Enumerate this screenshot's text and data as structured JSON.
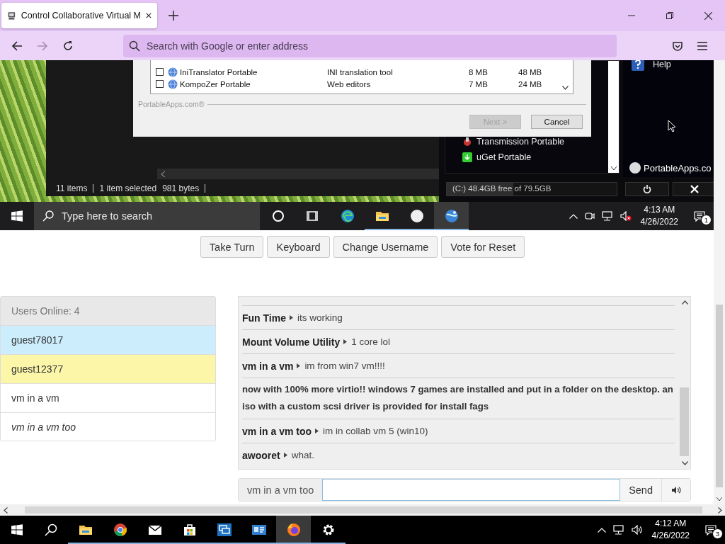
{
  "browser": {
    "tab": {
      "title": "Control Collaborative Virtual M",
      "selected": true
    },
    "nav": [
      {
        "kind": "back",
        "disabled": false
      },
      {
        "kind": "forward",
        "disabled": true
      },
      {
        "kind": "reload",
        "disabled": false
      }
    ],
    "address_placeholder": "Search with Google or enter address"
  },
  "vm_screen": {
    "installer": {
      "rows": [
        {
          "name": "IniTranslator Portable",
          "description": "INI translation tool",
          "column_3": "8 MB",
          "column_4": "48 MB",
          "checked": false
        },
        {
          "name": "KompoZer Portable",
          "description": "Web editors",
          "column_3": "7 MB",
          "column_4": "24 MB",
          "checked": false
        }
      ],
      "brand": "PortableApps.com®",
      "buttons": [
        {
          "label": "Next >",
          "disabled": true
        },
        {
          "label": "Cancel",
          "disabled": false
        }
      ]
    },
    "explorer_status": [
      "11 items",
      "1 item selected",
      "981 bytes"
    ],
    "menu": {
      "items": [
        {
          "label": "Transmission Portable",
          "kind": "transmission"
        },
        {
          "label": "uGet Portable",
          "kind": "uget"
        }
      ],
      "help": "Help",
      "logo": "PortableApps.co",
      "disk": "(C:) 48.4GB free of 79.5GB",
      "level": 0.39
    },
    "taskbar": {
      "search_placeholder": "Type here to search",
      "apps": [
        {
          "kind": "cortana",
          "running": false,
          "active": false
        },
        {
          "kind": "taskview",
          "running": false,
          "active": false
        },
        {
          "kind": "edge",
          "running": false,
          "active": false
        },
        {
          "kind": "folder",
          "running": true,
          "active": false
        },
        {
          "kind": "portableapps",
          "running": true,
          "active": false
        },
        {
          "kind": "globe",
          "running": true,
          "active": true
        }
      ],
      "time": "4:13 AM",
      "date": "4/26/2022",
      "notifications": "1"
    }
  },
  "controls": [
    "Take Turn",
    "Keyboard",
    "Change Username",
    "Vote for Reset"
  ],
  "users": {
    "header": "Users Online: 4",
    "items": [
      {
        "name": "guest78017",
        "kind": "turn"
      },
      {
        "name": "guest12377",
        "kind": "self"
      },
      {
        "name": "vm in a vm",
        "kind": "plain"
      },
      {
        "name": "vm in a vm too",
        "kind": "waiting"
      }
    ]
  },
  "chat": {
    "messages": [
      {
        "kind": "message",
        "username": "Fun Time",
        "text": "its working"
      },
      {
        "kind": "message",
        "username": "Mount Volume Utility",
        "text": "1 core lol"
      },
      {
        "kind": "message",
        "username": "vm in a vm",
        "text": "im from win7 vm!!!!"
      },
      {
        "kind": "notice",
        "text": "now with 100% more virtio!! windows 7 games are installed and put in a folder on the desktop. an iso with a custom scsi driver is provided for install fags"
      },
      {
        "kind": "message",
        "username": "vm in a vm too",
        "text": "im in collab vm 5 (win10)"
      },
      {
        "kind": "message",
        "username": "awooret",
        "text": "what."
      }
    ],
    "input_username": "vm in a vm too",
    "send": "Send"
  },
  "host_taskbar": {
    "apps": [
      {
        "kind": "folder",
        "running": true,
        "active": false
      },
      {
        "kind": "chrome",
        "running": true,
        "active": false
      },
      {
        "kind": "mail",
        "running": true,
        "active": false
      },
      {
        "kind": "store",
        "running": true,
        "active": false
      },
      {
        "kind": "remote",
        "running": true,
        "active": false
      },
      {
        "kind": "card",
        "running": true,
        "active": false
      },
      {
        "kind": "firefox",
        "running": true,
        "active": true
      },
      {
        "kind": "gear",
        "running": true,
        "active": false
      }
    ],
    "time": "4:12 AM",
    "date": "4/26/2022",
    "notifications": "3"
  }
}
